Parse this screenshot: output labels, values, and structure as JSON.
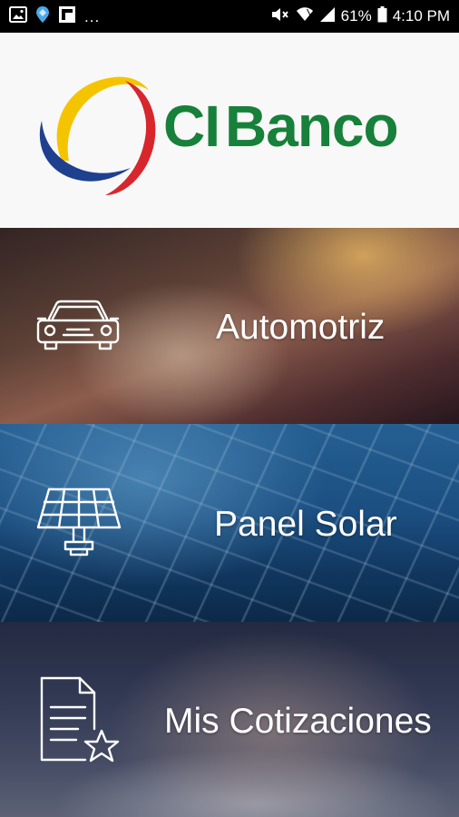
{
  "status_bar": {
    "left_icons": [
      "image-icon",
      "location-drop-icon",
      "flipboard-icon"
    ],
    "overflow": "...",
    "right_icons": [
      "mute-icon",
      "wifi-icon",
      "signal-icon"
    ],
    "battery": "61%",
    "time": "4:10 PM"
  },
  "brand": {
    "name_part1": "CI",
    "name_part2": "Banco",
    "colors": {
      "green": "#17803a",
      "yellow": "#f5c400",
      "red": "#d8262d",
      "blue": "#1f3f8f"
    }
  },
  "menu": {
    "items": [
      {
        "label": "Automotriz",
        "icon": "car-icon"
      },
      {
        "label": "Panel Solar",
        "icon": "solar-panel-icon"
      },
      {
        "label": "Mis Cotizaciones",
        "icon": "document-star-icon"
      }
    ]
  }
}
